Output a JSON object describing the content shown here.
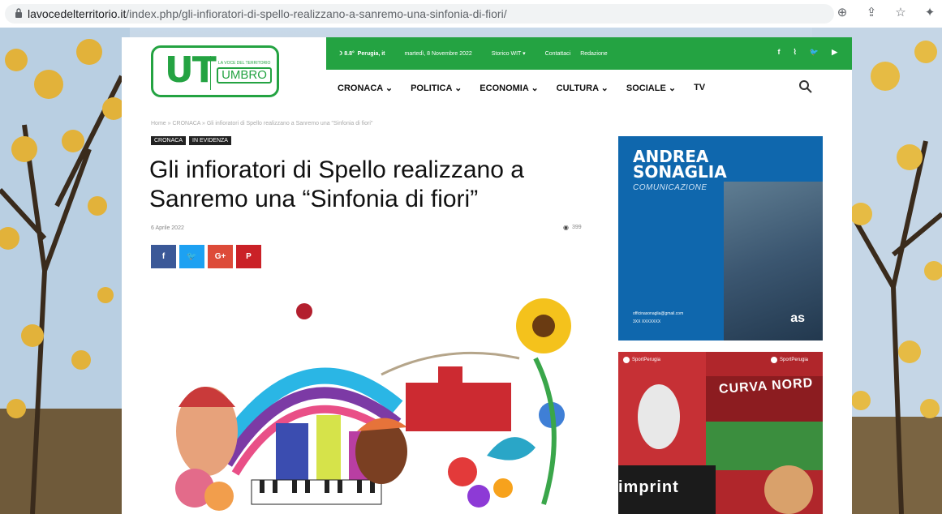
{
  "browser": {
    "url_host": "lavocedelterritorio.it",
    "url_path": "/index.php/gli-infioratori-di-spello-realizzano-a-sanremo-una-sinfonia-di-fiori/",
    "icons": [
      "zoom-icon",
      "share-icon",
      "star-icon",
      "extension-icon"
    ]
  },
  "site": {
    "logo_main": "UT",
    "logo_tag": "LA VOCE DEL TERRITORIO",
    "logo_sub": "UMBRO",
    "topbar": {
      "weather": "8.8°",
      "city": "Perugia, it",
      "date": "martedì, 8 Novembre 2022",
      "storico": "Storico WIT ▾",
      "contatti": "Contattaci",
      "redazione": "Redazione",
      "social": [
        "f",
        "ʃ",
        "t",
        "▶"
      ]
    },
    "nav": [
      "CRONACA ⌄",
      "POLITICA ⌄",
      "ECONOMIA ⌄",
      "CULTURA ⌄",
      "SOCIALE ⌄",
      "TV"
    ]
  },
  "article": {
    "breadcrumb": "Home  »  CRONACA  »  Gli infioratori di Spello realizzano a Sanremo una \"Sinfonia di fiori\"",
    "tags": [
      "CRONACA",
      "IN EVIDENZA"
    ],
    "title": "Gli infioratori di Spello realizzano a Sanremo una “Sinfonia di fiori”",
    "date": "6 Aprile 2022",
    "views": "399",
    "share": [
      {
        "label": "f",
        "color": "#3b5998"
      },
      {
        "label": "t",
        "color": "#1da1f2"
      },
      {
        "label": "G+",
        "color": "#dd4b39"
      },
      {
        "label": "P",
        "color": "#ca2127"
      }
    ]
  },
  "ads": {
    "ad1_name_line1": "ANDREA",
    "ad1_name_line2": "SONAGLIA",
    "ad1_sub": "COMUNICAZIONE",
    "ad1_contact1": "officinasonaglia@gmail.com",
    "ad1_contact2": "3XX XXXXXXX",
    "ad1_mono": "as",
    "ad2_ig1": "SportPerugia",
    "ad2_ig2": "SportPerugia",
    "ad2_banner": "CURVA NORD",
    "ad2_imprint": "imprint"
  },
  "colors": {
    "brand_green": "#24a342",
    "ad_blue": "#0f67ad",
    "ad_red": "#b0262b"
  }
}
